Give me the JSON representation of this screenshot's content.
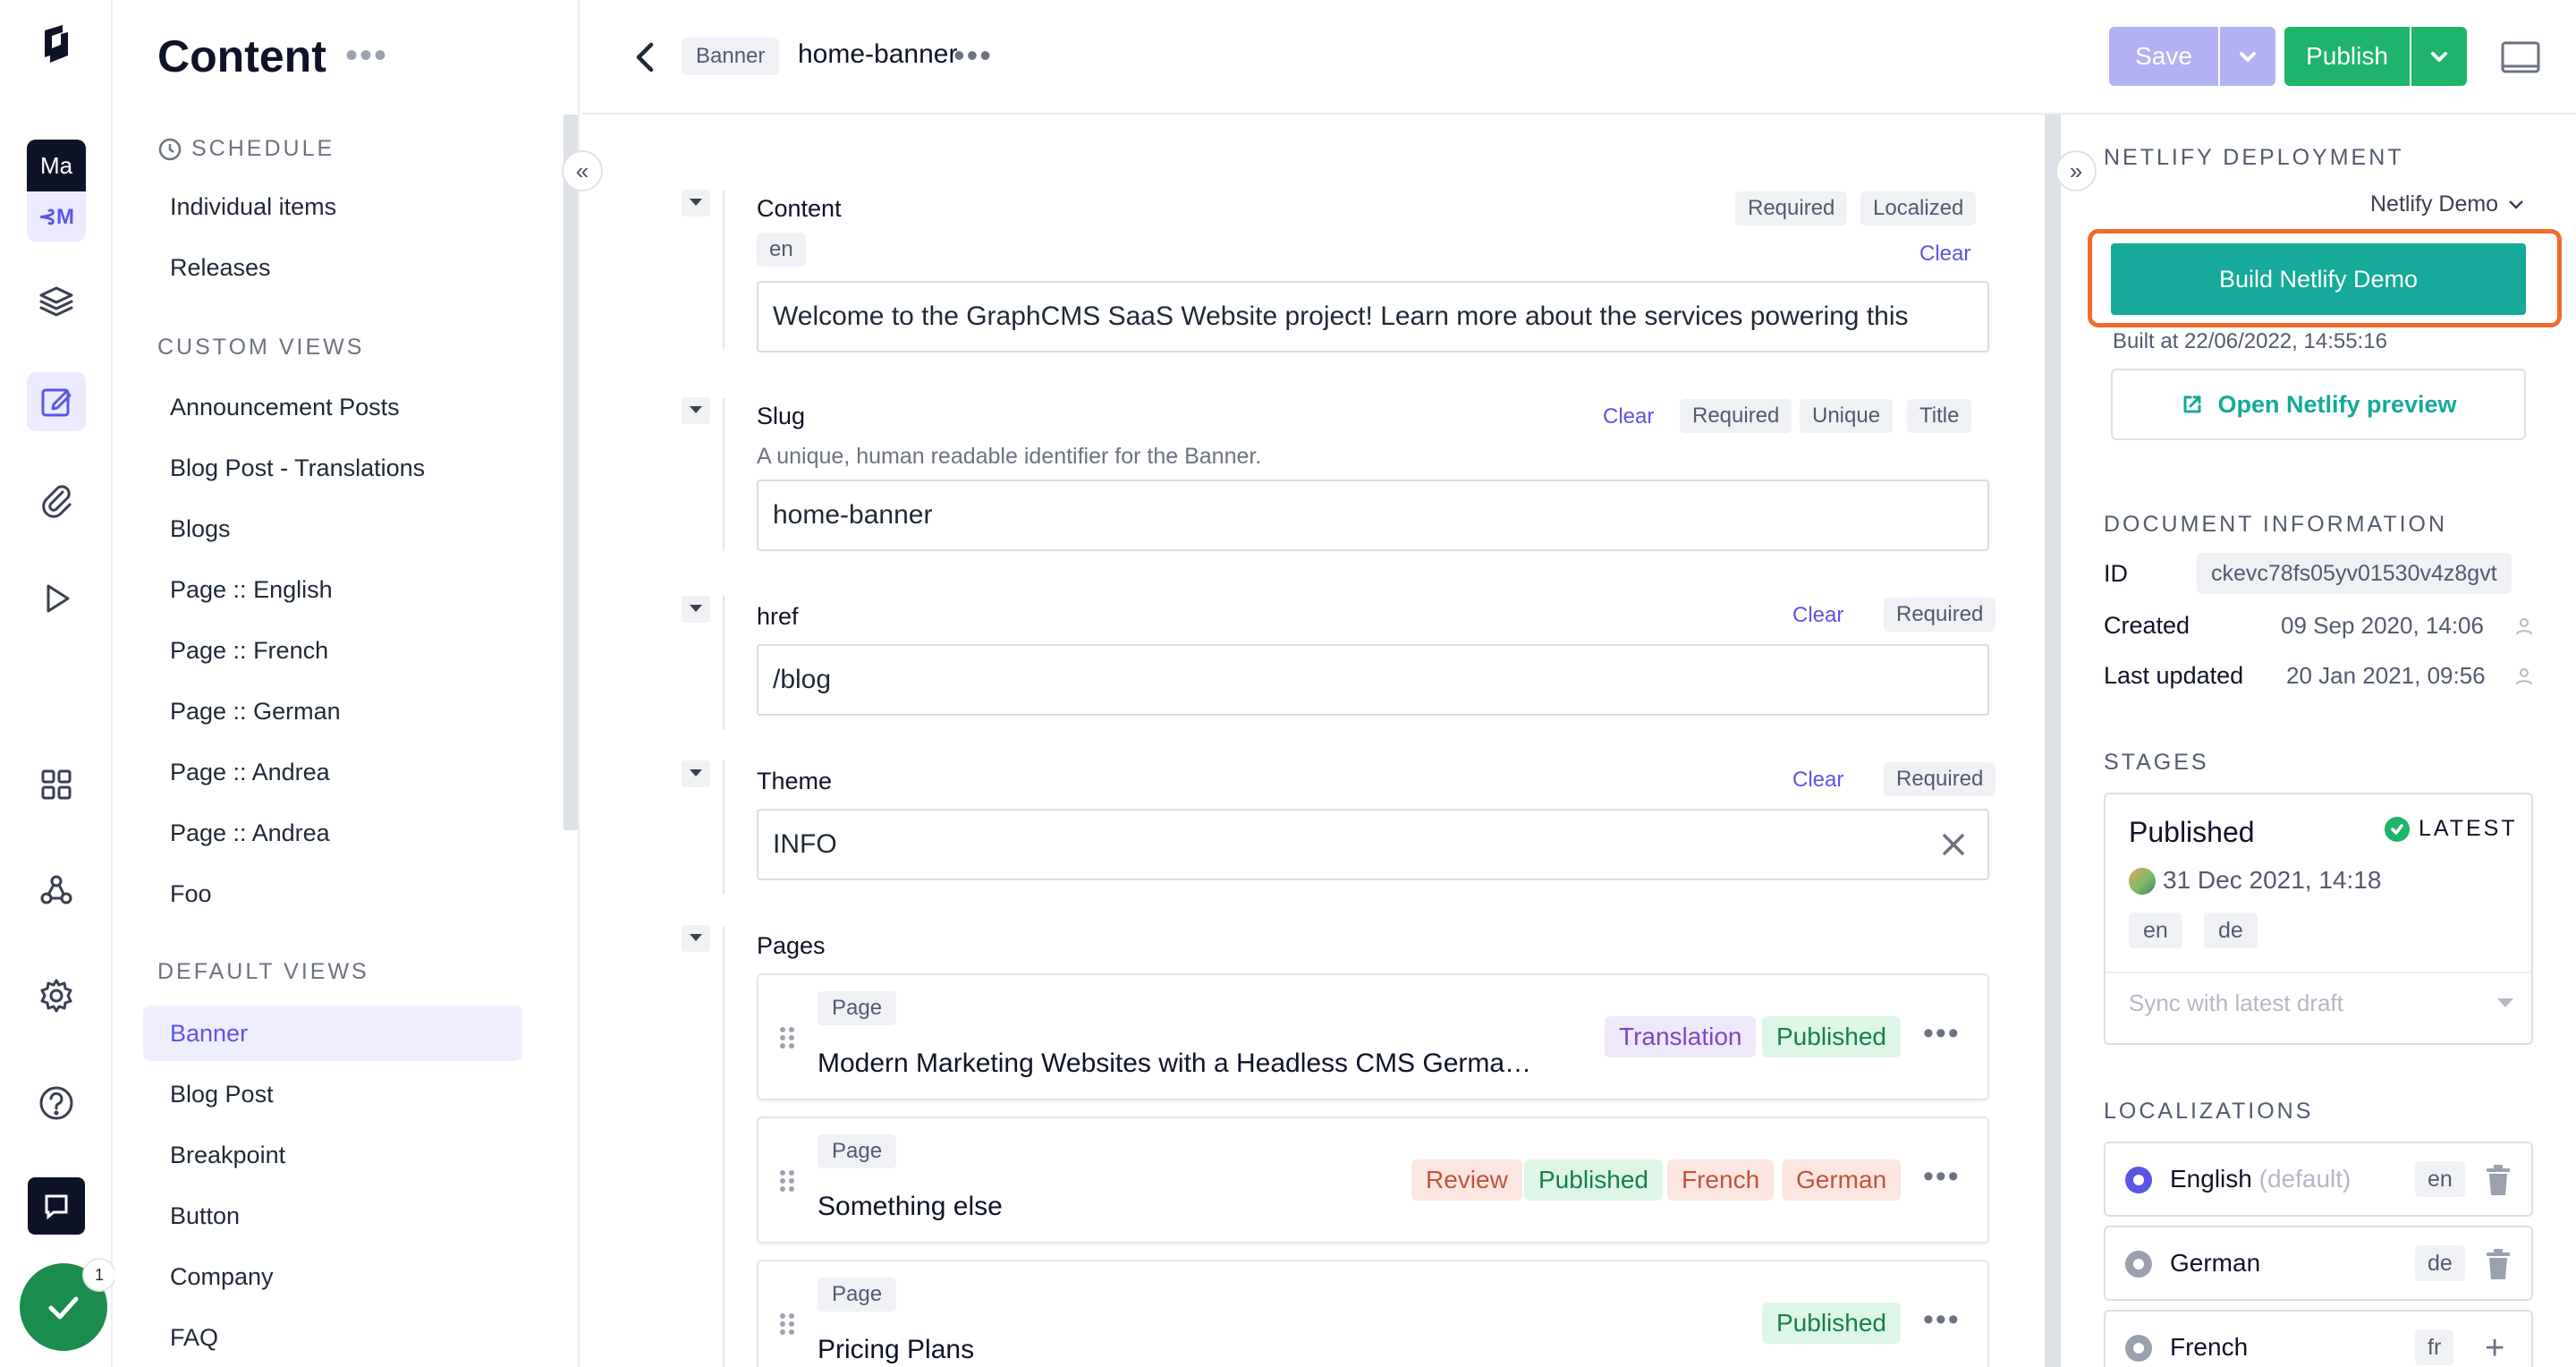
{
  "rail": {
    "env_badge_top": "Ma",
    "env_badge_bottom": "⊰M",
    "notification_count": "1"
  },
  "sidebar": {
    "title": "Content",
    "schedule_heading": "SCHEDULE",
    "schedule_items": [
      "Individual items",
      "Releases"
    ],
    "custom_views_heading": "CUSTOM VIEWS",
    "custom_views": [
      "Announcement Posts",
      "Blog Post - Translations",
      "Blogs",
      "Page :: English",
      "Page :: French",
      "Page :: German",
      "Page :: Andrea",
      "Page :: Andrea",
      "Foo"
    ],
    "default_views_heading": "DEFAULT VIEWS",
    "default_views": [
      "Banner",
      "Blog Post",
      "Breakpoint",
      "Button",
      "Company",
      "FAQ"
    ],
    "selected_default_view": "Banner"
  },
  "topbar": {
    "model": "Banner",
    "document_title": "home-banner",
    "save_label": "Save",
    "publish_label": "Publish"
  },
  "fields": {
    "content": {
      "label": "Content",
      "tags": [
        "Required",
        "Localized"
      ],
      "locale": "en",
      "clear": "Clear",
      "value": "Welcome to the GraphCMS SaaS Website project! Learn more about the services powering this"
    },
    "slug": {
      "label": "Slug",
      "help": "A unique, human readable identifier for the Banner.",
      "clear": "Clear",
      "tags": [
        "Required",
        "Unique",
        "Title"
      ],
      "value": "home-banner"
    },
    "href": {
      "label": "href",
      "clear": "Clear",
      "tags": [
        "Required"
      ],
      "value": "/blog"
    },
    "theme": {
      "label": "Theme",
      "clear": "Clear",
      "tags": [
        "Required"
      ],
      "value": "INFO"
    },
    "pages": {
      "label": "Pages",
      "items": [
        {
          "model": "Page",
          "title": "Modern Marketing Websites with a Headless CMS Germa…",
          "statuses": [
            "Translation",
            "Published"
          ]
        },
        {
          "model": "Page",
          "title": "Something else",
          "statuses": [
            "Review",
            "Published",
            "French",
            "German"
          ]
        },
        {
          "model": "Page",
          "title": "Pricing Plans",
          "statuses": [
            "Published"
          ]
        }
      ]
    }
  },
  "right_panel": {
    "netlify_heading": "NETLIFY DEPLOYMENT",
    "netlify_site": "Netlify Demo",
    "build_button": "Build Netlify Demo",
    "built_at": "Built at 22/06/2022, 14:55:16",
    "preview_button": "Open Netlify preview",
    "doc_info_heading": "DOCUMENT INFORMATION",
    "id_label": "ID",
    "id_value": "ckevc78fs05yv01530v4z8gvt",
    "created_label": "Created",
    "created_value": "09 Sep 2020, 14:06",
    "updated_label": "Last updated",
    "updated_value": "20 Jan 2021, 09:56",
    "stages_heading": "STAGES",
    "stage": {
      "name": "Published",
      "badge": "LATEST",
      "date": "31 Dec 2021, 14:18",
      "locales": [
        "en",
        "de"
      ],
      "sync_placeholder": "Sync with latest draft"
    },
    "localizations_heading": "LOCALIZATIONS",
    "localizations": [
      {
        "name": "English",
        "suffix": "(default)",
        "code": "en",
        "enabled": true
      },
      {
        "name": "German",
        "suffix": "",
        "code": "de",
        "enabled": false
      },
      {
        "name": "French",
        "suffix": "",
        "code": "fr",
        "enabled": false
      }
    ]
  },
  "colors": {
    "accent": "#5b55e6",
    "publish_green": "#1fb46c",
    "netlify_teal": "#15aa99",
    "highlight_orange": "#f06b2c"
  }
}
